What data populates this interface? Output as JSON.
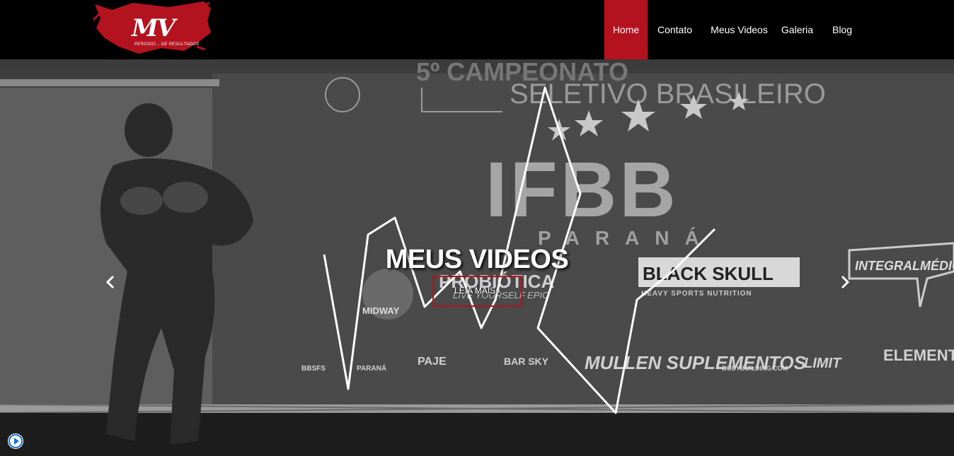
{
  "header": {
    "logo": {
      "initials": "MV",
      "tagline": "PERIODO... DE RESULTADOS"
    },
    "nav": [
      {
        "label": "Home",
        "active": true
      },
      {
        "label": "Contato",
        "active": false
      },
      {
        "label": "Meus Videos",
        "active": false
      },
      {
        "label": "Galeria",
        "active": false
      },
      {
        "label": "Blog",
        "active": false
      }
    ]
  },
  "hero": {
    "title": "MEUS VIDEOS",
    "button_label": "LEIA MAIS»",
    "prev_icon": "chevron-left-icon",
    "next_icon": "chevron-right-icon",
    "backdrop": {
      "event_line1": "5º CAMPEONATO",
      "event_line2": "SELETIVO BRASILEIRO",
      "federation": "IFBB",
      "state": "PARANÁ",
      "sponsors": [
        "PROBIÓTICA",
        "BLACK SKULL",
        "INTEGRALMÉDICA",
        "MIDWAY",
        "BBSFS",
        "PARANÁ",
        "PAJE",
        "BAR SKY",
        "MULLEN SUPLEMENTOS",
        "BODYBUILDING.COM",
        "LIMIT",
        "ELEMENT"
      ],
      "sponsor_sub1": "LIVE YOURSELF EPIC",
      "sponsor_sub2": "HEAVY SPORTS NUTRITION"
    }
  },
  "colors": {
    "accent": "#b3121f",
    "header_bg": "#000000",
    "text": "#ffffff"
  }
}
